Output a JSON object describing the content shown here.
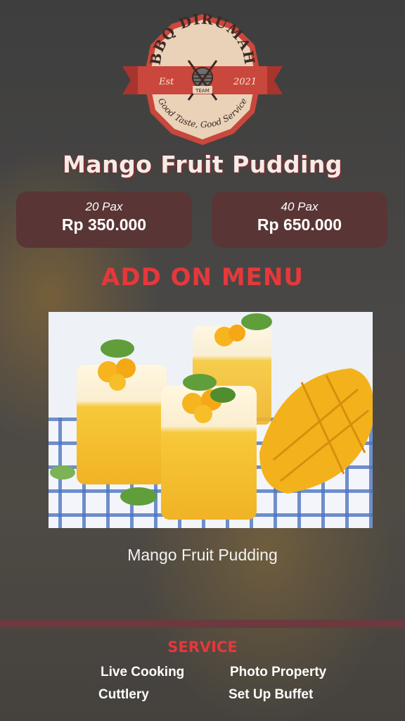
{
  "logo": {
    "brand": "BBQ DIRUMAH",
    "est_label": "Est",
    "year": "2021",
    "team": "TEAM",
    "tagline": "Good Taste, Good Service"
  },
  "title": "Mango Fruit Pudding",
  "prices": [
    {
      "pax": "20 Pax",
      "amount": "Rp 350.000"
    },
    {
      "pax": "40 Pax",
      "amount": "Rp 650.000"
    }
  ],
  "addon_heading": "ADD ON MENU",
  "photo_caption": "Mango Fruit Pudding",
  "service": {
    "heading": "SERVICE",
    "items": [
      "Live Cooking",
      "Photo Property",
      "Cuttlery",
      "Set Up Buffet"
    ]
  },
  "colors": {
    "accent_red": "#e5383b",
    "card_brown": "#5a3535",
    "logo_ribbon": "#c9473c",
    "logo_badge": "#e9d2b8"
  }
}
